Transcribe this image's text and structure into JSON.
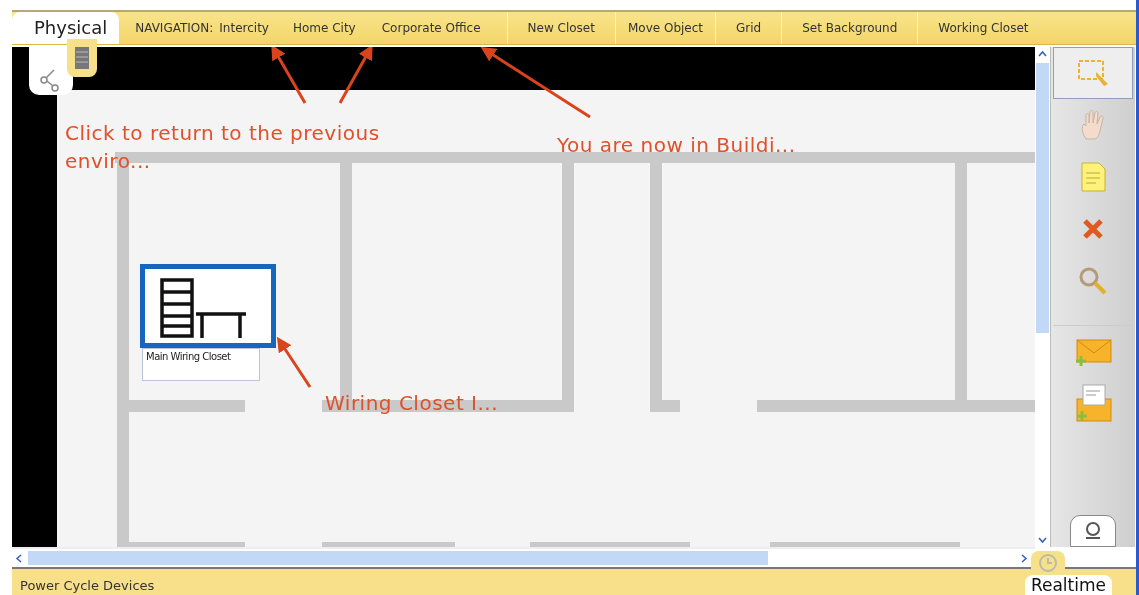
{
  "mode_tab": {
    "label": "Physical",
    "selected": true
  },
  "navigation": {
    "label": "NAVIGATION:",
    "items": [
      {
        "label": "Intercity"
      },
      {
        "label": "Home City"
      },
      {
        "label": "Corporate Office"
      }
    ]
  },
  "toolbar_buttons": [
    "New Closet",
    "Move Object",
    "Grid",
    "Set Background",
    "Working Closet"
  ],
  "device": {
    "label": "Main Wiring Closet",
    "selected": true
  },
  "annotations": [
    {
      "text": "Click to return to the previous enviro..."
    },
    {
      "text": "You are now in Buildi..."
    },
    {
      "text": "Wiring Closet I..."
    }
  ],
  "tools": [
    {
      "kind": "select",
      "selected": true
    },
    {
      "kind": "move",
      "selected": false
    },
    {
      "kind": "note",
      "selected": false
    },
    {
      "kind": "delete",
      "selected": false
    },
    {
      "kind": "inspect",
      "selected": false
    },
    {
      "kind": "simple-pdu",
      "selected": false
    },
    {
      "kind": "complex-pdu",
      "selected": false
    }
  ],
  "status_bar": {
    "text": "Power Cycle Devices",
    "time_mode": "Realtime"
  }
}
